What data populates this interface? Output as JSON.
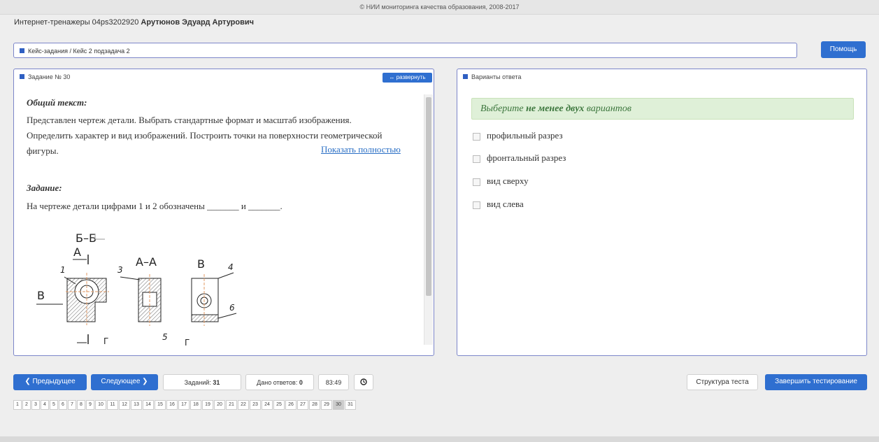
{
  "header": {
    "copyright": "© НИИ мониторинга качества образования, 2008-2017"
  },
  "user": {
    "prefix": "Интернет-тренажеры 04ps3202920",
    "name": "Арутюнов Эдуард Артурович"
  },
  "breadcrumb": {
    "text": "Кейс-задания / Кейс 2 подзадача 2"
  },
  "help_button": "Помощь",
  "task_panel": {
    "title": "Задание № 30",
    "expand_label": "↔ развернуть",
    "general_heading": "Общий текст:",
    "general_text": "Представлен чертеж детали. Выбрать стандартные формат и масштаб изображения. Определить характер и вид изображений. Построить точки на поверхности геометрической фигуры.",
    "show_full_link": "Показать полностью",
    "task_heading": "Задание:",
    "task_text": "На чертеже детали цифрами 1 и 2 обозначены _______ и _______.",
    "drawing_labels": {
      "bb": "Б–Б",
      "a": "А",
      "aa": "А–А",
      "b_left": "В",
      "b_right": "В",
      "n1": "1",
      "n3": "3",
      "n4": "4",
      "n5": "5",
      "n6": "6",
      "g1": "Г",
      "g2": "Г"
    }
  },
  "answers_panel": {
    "title": "Варианты ответа",
    "hint_prefix": "Выберите",
    "hint_bold": "не менее двух",
    "hint_suffix": "вариантов",
    "options": [
      "профильный разрез",
      "фронтальный разрез",
      "вид сверху",
      "вид слева"
    ]
  },
  "footer_nav": {
    "prev": "❮ Предыдущее",
    "next": "Следующее ❯",
    "tasks_label": "Заданий:",
    "tasks_count": "31",
    "answers_label": "Дано ответов:",
    "answers_count": "0",
    "timer": "83:49",
    "structure_button": "Структура теста",
    "finish_button": "Завершить тестирование",
    "current_page": 30,
    "pages": [
      "1",
      "2",
      "3",
      "4",
      "5",
      "6",
      "7",
      "8",
      "9",
      "10",
      "11",
      "12",
      "13",
      "14",
      "15",
      "16",
      "17",
      "18",
      "19",
      "20",
      "21",
      "22",
      "23",
      "24",
      "25",
      "26",
      "27",
      "28",
      "29",
      "30",
      "31"
    ]
  }
}
